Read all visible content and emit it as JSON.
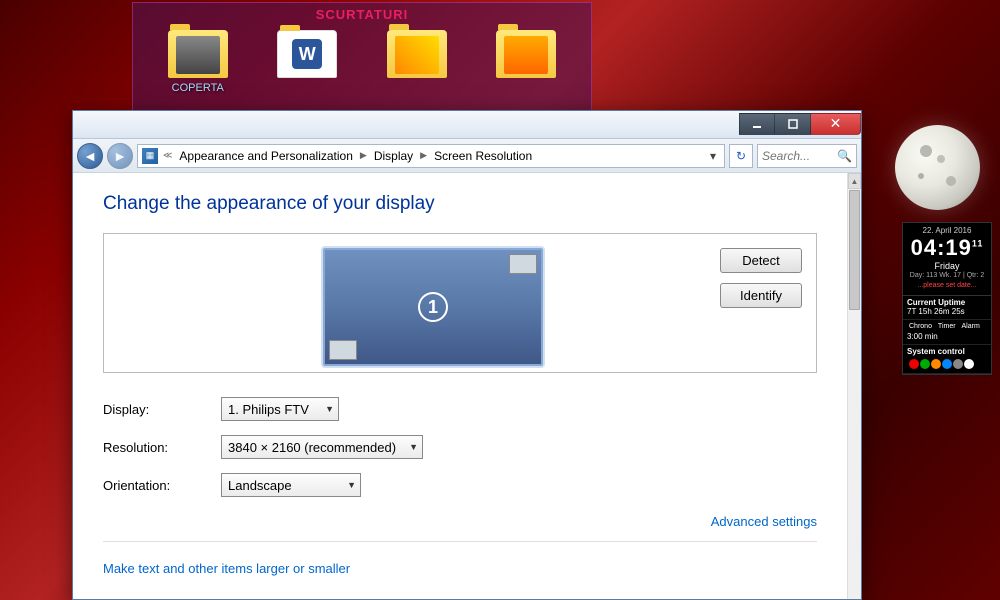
{
  "desktop": {
    "scurtaturi_title": "SCURTATURI",
    "folders": [
      "COPERTA",
      "",
      "",
      ""
    ]
  },
  "clock": {
    "date": "22. April 2016",
    "time": "04:19",
    "seconds": "11",
    "day": "Friday",
    "info1": "Day: 113 Wk. 17 | Qtr: 2",
    "info2": "...please set date...",
    "uptime_label": "Current Uptime",
    "uptime_value": "7T 15h 26m 25s",
    "tabs": [
      "Chrono",
      "Timer",
      "Alarm"
    ],
    "timer": "3:00 min",
    "sys_label": "System control"
  },
  "window": {
    "breadcrumb": [
      "Appearance and Personalization",
      "Display",
      "Screen Resolution"
    ],
    "search_placeholder": "Search...",
    "heading": "Change the appearance of your display",
    "monitor_number": "1",
    "detect_btn": "Detect",
    "identify_btn": "Identify",
    "labels": {
      "display": "Display:",
      "resolution": "Resolution:",
      "orientation": "Orientation:"
    },
    "values": {
      "display": "1. Philips FTV",
      "resolution": "3840 × 2160 (recommended)",
      "orientation": "Landscape"
    },
    "advanced_link": "Advanced settings",
    "text_size_link": "Make text and other items larger or smaller"
  }
}
